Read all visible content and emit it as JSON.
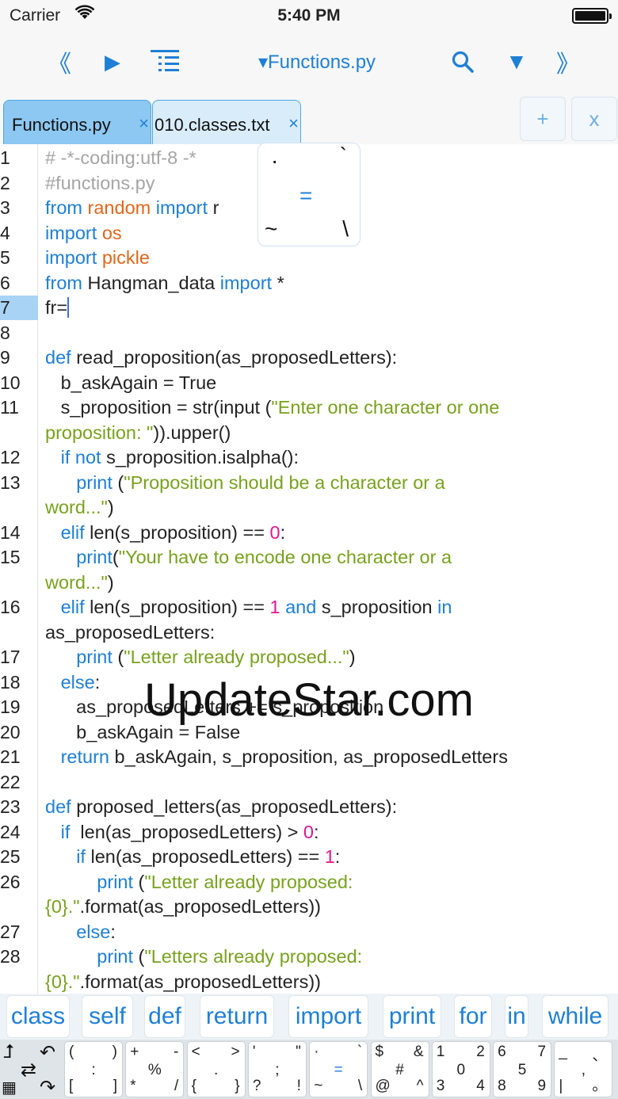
{
  "status_bar": {
    "carrier": "Carrier",
    "time": "5:40 PM"
  },
  "toolbar": {
    "prev_glyph": "《",
    "play_glyph": "▶",
    "file_menu": "▾Functions.py",
    "down_glyph": "▼",
    "next_glyph": "》"
  },
  "tabs": [
    {
      "label": "Functions.py",
      "close": "×",
      "active": true
    },
    {
      "label": "010.classes.txt",
      "close": "×",
      "active": false
    }
  ],
  "tab_buttons": {
    "add": "+",
    "close_all": "x"
  },
  "editor": {
    "current_line": "7",
    "line_numbers": [
      "1",
      "2",
      "3",
      "4",
      "5",
      "6",
      "7",
      "8",
      "9",
      "10",
      "11",
      "",
      "12",
      "13",
      "",
      "14",
      "15",
      "",
      "16",
      "",
      "17",
      "18",
      "19",
      "20",
      "21",
      "22",
      "23",
      "24",
      "25",
      "26",
      "",
      "27",
      "28",
      ""
    ],
    "lines": [
      [
        {
          "t": "# -*-coding:utf-8 -*",
          "c": "cmt"
        }
      ],
      [
        {
          "t": "#functions.py",
          "c": "cmt"
        }
      ],
      [
        {
          "t": "from",
          "c": "kw"
        },
        {
          "t": " "
        },
        {
          "t": "random",
          "c": "mod"
        },
        {
          "t": " "
        },
        {
          "t": "import",
          "c": "kw"
        },
        {
          "t": " r"
        }
      ],
      [
        {
          "t": "import",
          "c": "kw"
        },
        {
          "t": " "
        },
        {
          "t": "os",
          "c": "mod"
        }
      ],
      [
        {
          "t": "import",
          "c": "kw"
        },
        {
          "t": " "
        },
        {
          "t": "pickle",
          "c": "mod"
        }
      ],
      [
        {
          "t": "from",
          "c": "kw"
        },
        {
          "t": " Hangman_data "
        },
        {
          "t": "import",
          "c": "kw"
        },
        {
          "t": " *"
        }
      ],
      [
        {
          "t": "fr="
        },
        {
          "caret": true
        }
      ],
      [],
      [
        {
          "t": "def",
          "c": "kw"
        },
        {
          "t": " read_proposition(as_proposedLetters):"
        }
      ],
      [
        {
          "t": "   b_askAgain = True"
        }
      ],
      [
        {
          "t": "   s_proposition = str(input ("
        },
        {
          "t": "\"Enter one character or one",
          "c": "str"
        }
      ],
      [
        {
          "t": "proposition: \"",
          "c": "str"
        },
        {
          "t": ")).upper()"
        }
      ],
      [
        {
          "t": "   "
        },
        {
          "t": "if not",
          "c": "kw"
        },
        {
          "t": " s_proposition.isalpha():"
        }
      ],
      [
        {
          "t": "      "
        },
        {
          "t": "print",
          "c": "kw"
        },
        {
          "t": " ("
        },
        {
          "t": "\"Proposition should be a character or a",
          "c": "str"
        }
      ],
      [
        {
          "t": "word...\"",
          "c": "str"
        },
        {
          "t": ")"
        }
      ],
      [
        {
          "t": "   "
        },
        {
          "t": "elif",
          "c": "kw"
        },
        {
          "t": " len(s_proposition) == "
        },
        {
          "t": "0",
          "c": "num"
        },
        {
          "t": ":"
        }
      ],
      [
        {
          "t": "      "
        },
        {
          "t": "print",
          "c": "kw"
        },
        {
          "t": "("
        },
        {
          "t": "\"Your have to encode one character or a",
          "c": "str"
        }
      ],
      [
        {
          "t": "word...\"",
          "c": "str"
        },
        {
          "t": ")"
        }
      ],
      [
        {
          "t": "   "
        },
        {
          "t": "elif",
          "c": "kw"
        },
        {
          "t": " len(s_proposition) == "
        },
        {
          "t": "1",
          "c": "num"
        },
        {
          "t": " "
        },
        {
          "t": "and",
          "c": "kw"
        },
        {
          "t": " s_proposition "
        },
        {
          "t": "in",
          "c": "kw"
        }
      ],
      [
        {
          "t": "as_proposedLetters:"
        }
      ],
      [
        {
          "t": "      "
        },
        {
          "t": "print",
          "c": "kw"
        },
        {
          "t": " ("
        },
        {
          "t": "\"Letter already proposed...\"",
          "c": "str"
        },
        {
          "t": ")"
        }
      ],
      [
        {
          "t": "   "
        },
        {
          "t": "else",
          "c": "kw"
        },
        {
          "t": ":"
        }
      ],
      [
        {
          "t": "      as_proposedLetters += s_proposition"
        }
      ],
      [
        {
          "t": "      b_askAgain = False"
        }
      ],
      [
        {
          "t": "   "
        },
        {
          "t": "return",
          "c": "kw"
        },
        {
          "t": " b_askAgain, s_proposition, as_proposedLetters"
        }
      ],
      [],
      [
        {
          "t": "def",
          "c": "kw"
        },
        {
          "t": " proposed_letters(as_proposedLetters):"
        }
      ],
      [
        {
          "t": "   "
        },
        {
          "t": "if",
          "c": "kw"
        },
        {
          "t": "  len(as_proposedLetters) > "
        },
        {
          "t": "0",
          "c": "num"
        },
        {
          "t": ":"
        }
      ],
      [
        {
          "t": "      "
        },
        {
          "t": "if",
          "c": "kw"
        },
        {
          "t": " len(as_proposedLetters) == "
        },
        {
          "t": "1",
          "c": "num"
        },
        {
          "t": ":"
        }
      ],
      [
        {
          "t": "          "
        },
        {
          "t": "print",
          "c": "kw"
        },
        {
          "t": " ("
        },
        {
          "t": "\"Letter already proposed:",
          "c": "str"
        }
      ],
      [
        {
          "t": "{0}.\"",
          "c": "str"
        },
        {
          "t": ".format(as_proposedLetters))"
        }
      ],
      [
        {
          "t": "      "
        },
        {
          "t": "else",
          "c": "kw"
        },
        {
          "t": ":"
        }
      ],
      [
        {
          "t": "          "
        },
        {
          "t": "print",
          "c": "kw"
        },
        {
          "t": " ("
        },
        {
          "t": "\"Letters already proposed:",
          "c": "str"
        }
      ],
      [
        {
          "t": "{0}.\"",
          "c": "str"
        },
        {
          "t": ".format(as_proposedLetters))"
        }
      ]
    ]
  },
  "popup_keys": {
    "tl": "·",
    "tr": "`",
    "center": "=",
    "bl": "~",
    "br": "\\"
  },
  "watermark": "UpdateStar.com",
  "keyword_bar": [
    "class",
    "self",
    "def",
    "return",
    "import",
    "print",
    "for",
    "in",
    "while"
  ],
  "nav_key": {
    "tl": "⮥",
    "tr": "↶",
    "mid": "⇄",
    "bl": "▦",
    "br": "↷"
  },
  "keyboard": [
    {
      "tl": "(",
      "tr": ")",
      "mc": ":",
      "bl": "[",
      "br": "]"
    },
    {
      "tl": "+",
      "tr": "-",
      "mc": "%",
      "bl": "*",
      "br": "/"
    },
    {
      "tl": "<",
      "tr": ">",
      "mc": ".",
      "bl": "{",
      "br": "}"
    },
    {
      "tl": "'",
      "tr": "\"",
      "mc": ";",
      "bl": "?",
      "br": "!"
    },
    {
      "tl": "·",
      "tr": "`",
      "mc": "=",
      "bl": "~",
      "br": "\\"
    },
    {
      "tl": "$",
      "tr": "&",
      "mc": "#",
      "bl": "@",
      "br": "^"
    },
    {
      "tl": "1",
      "tr": "2",
      "mc": "0",
      "bl": "3",
      "br": "4"
    },
    {
      "tl": "6",
      "tr": "7",
      "mc": "5",
      "bl": "8",
      "br": "9"
    },
    {
      "tl": "_",
      "tr": "、",
      "mc": ",",
      "bl": "|",
      "br": "。"
    }
  ]
}
